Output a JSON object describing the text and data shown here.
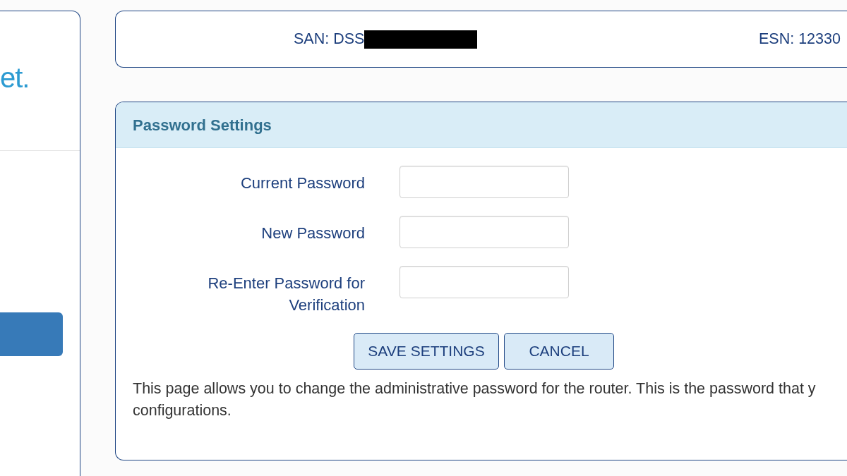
{
  "sidebar": {
    "logo": "et.",
    "nav_items": [
      {
        "selected": true
      }
    ]
  },
  "device_info": [
    {
      "label": "SAN: DSS",
      "redacted": true
    },
    {
      "label": "ESN: 12330",
      "redacted": false
    }
  ],
  "password_settings": {
    "title": "Password Settings",
    "fields": [
      {
        "label": "Current Password"
      },
      {
        "label": "New Password"
      },
      {
        "label": "Re-Enter Password for Verification"
      }
    ],
    "buttons": [
      {
        "label": "SAVE SETTINGS",
        "kind": "save"
      },
      {
        "label": "CANCEL",
        "kind": "cancel"
      }
    ],
    "description": "This page allows you to change the administrative password for the router. This is the password that y\nconfigurations."
  }
}
